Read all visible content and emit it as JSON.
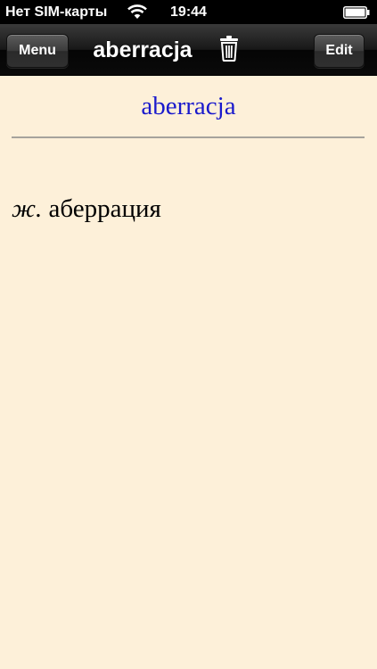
{
  "status_bar": {
    "carrier": "Нет SIM-карты",
    "time": "19:44",
    "wifi_icon": "wifi-icon",
    "battery_icon": "battery-icon"
  },
  "nav_bar": {
    "menu_label": "Menu",
    "title": "aberracja",
    "trash_icon": "trash-icon",
    "edit_label": "Edit"
  },
  "content": {
    "headword": "aberracja",
    "grammar": "ж.",
    "translation": "аберрация"
  },
  "colors": {
    "background": "#fdf0d9",
    "headword": "#1a1acc",
    "rule": "#a6a39c"
  }
}
